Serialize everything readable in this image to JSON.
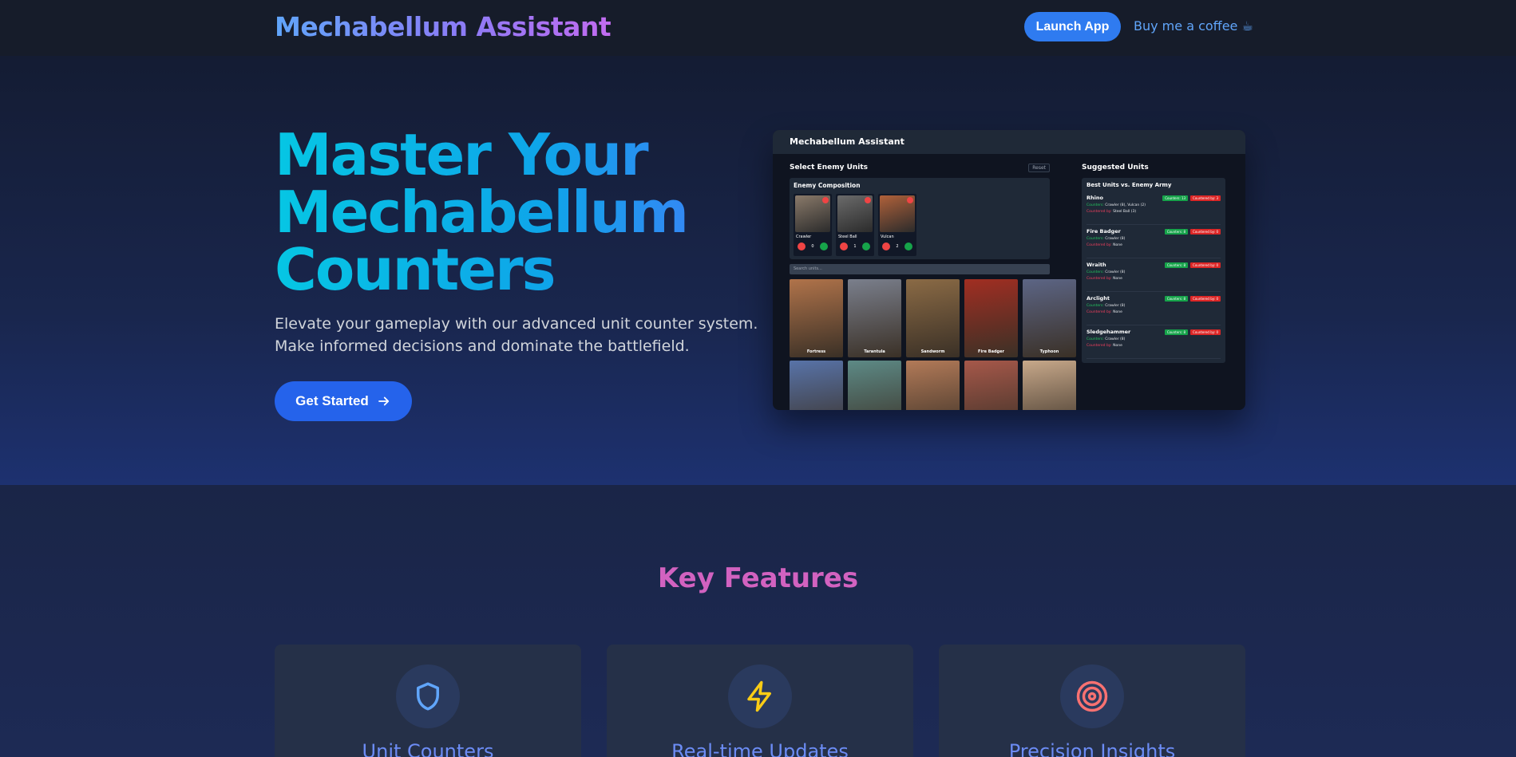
{
  "nav": {
    "brand": "Mechabellum Assistant",
    "launch_label": "Launch App",
    "coffee_label": "Buy me a coffee ☕"
  },
  "hero": {
    "title_lines": [
      "Master Your",
      "Mechabellum",
      "Counters"
    ],
    "subtitle_lines": [
      "Elevate your gameplay with our advanced unit counter system.",
      "Make informed decisions and dominate the battlefield."
    ],
    "cta_label": "Get Started"
  },
  "preview": {
    "app_title": "Mechabellum Assistant",
    "select_label": "Select Enemy Units",
    "reset_label": "Reset",
    "composition_title": "Enemy Composition",
    "composition": [
      {
        "name": "Crawler",
        "count": "0",
        "color": "#8a7a6a"
      },
      {
        "name": "Steel Ball",
        "count": "1",
        "color": "#6b6b6b"
      },
      {
        "name": "Vulcan",
        "count": "2",
        "color": "#b0613a"
      }
    ],
    "search_placeholder": "Search units...",
    "unit_cards": [
      {
        "name": "Fortress",
        "color": "#b0734a"
      },
      {
        "name": "Tarantula",
        "color": "#7a7f8c"
      },
      {
        "name": "Sandworm",
        "color": "#8a6a45"
      },
      {
        "name": "Fire Badger",
        "color": "#a12e22"
      },
      {
        "name": "Typhoon",
        "color": "#5c6585"
      },
      {
        "name": "",
        "color": "#5873a8"
      },
      {
        "name": "",
        "color": "#5d8a86"
      },
      {
        "name": "",
        "color": "#b27a58"
      },
      {
        "name": "",
        "color": "#a6584a"
      },
      {
        "name": "",
        "color": "#c7a88a"
      }
    ],
    "suggested_label": "Suggested Units",
    "suggest_title": "Best Units vs. Enemy Army",
    "suggestions": [
      {
        "name": "Rhino",
        "counters_tag": "Counters: 13",
        "countered_tag": "Countered by: 3",
        "counters_prefix": "Counters:",
        "counters": "Crawler (8), Vulcan (2)",
        "countered_prefix": "Countered by:",
        "countered": "Steel Ball (3)"
      },
      {
        "name": "Fire Badger",
        "counters_tag": "Counters: 8",
        "countered_tag": "Countered by: 0",
        "counters_prefix": "Counters:",
        "counters": "Crawler (8)",
        "countered_prefix": "Countered by:",
        "countered": "None"
      },
      {
        "name": "Wraith",
        "counters_tag": "Counters: 8",
        "countered_tag": "Countered by: 0",
        "counters_prefix": "Counters:",
        "counters": "Crawler (8)",
        "countered_prefix": "Countered by:",
        "countered": "None"
      },
      {
        "name": "Arclight",
        "counters_tag": "Counters: 8",
        "countered_tag": "Countered by: 0",
        "counters_prefix": "Counters:",
        "counters": "Crawler (8)",
        "countered_prefix": "Countered by:",
        "countered": "None"
      },
      {
        "name": "Sledgehammer",
        "counters_tag": "Counters: 8",
        "countered_tag": "Countered by: 0",
        "counters_prefix": "Counters:",
        "counters": "Crawler (8)",
        "countered_prefix": "Countered by:",
        "countered": "None"
      }
    ]
  },
  "features": {
    "title": "Key Features",
    "cards": [
      {
        "title": "Unit Counters",
        "icon": "shield-icon",
        "icon_color": "#60a5fa"
      },
      {
        "title": "Real-time Updates",
        "icon": "lightning-icon",
        "icon_color": "#facc15"
      },
      {
        "title": "Precision Insights",
        "icon": "target-icon",
        "icon_color": "#f87171"
      }
    ]
  }
}
